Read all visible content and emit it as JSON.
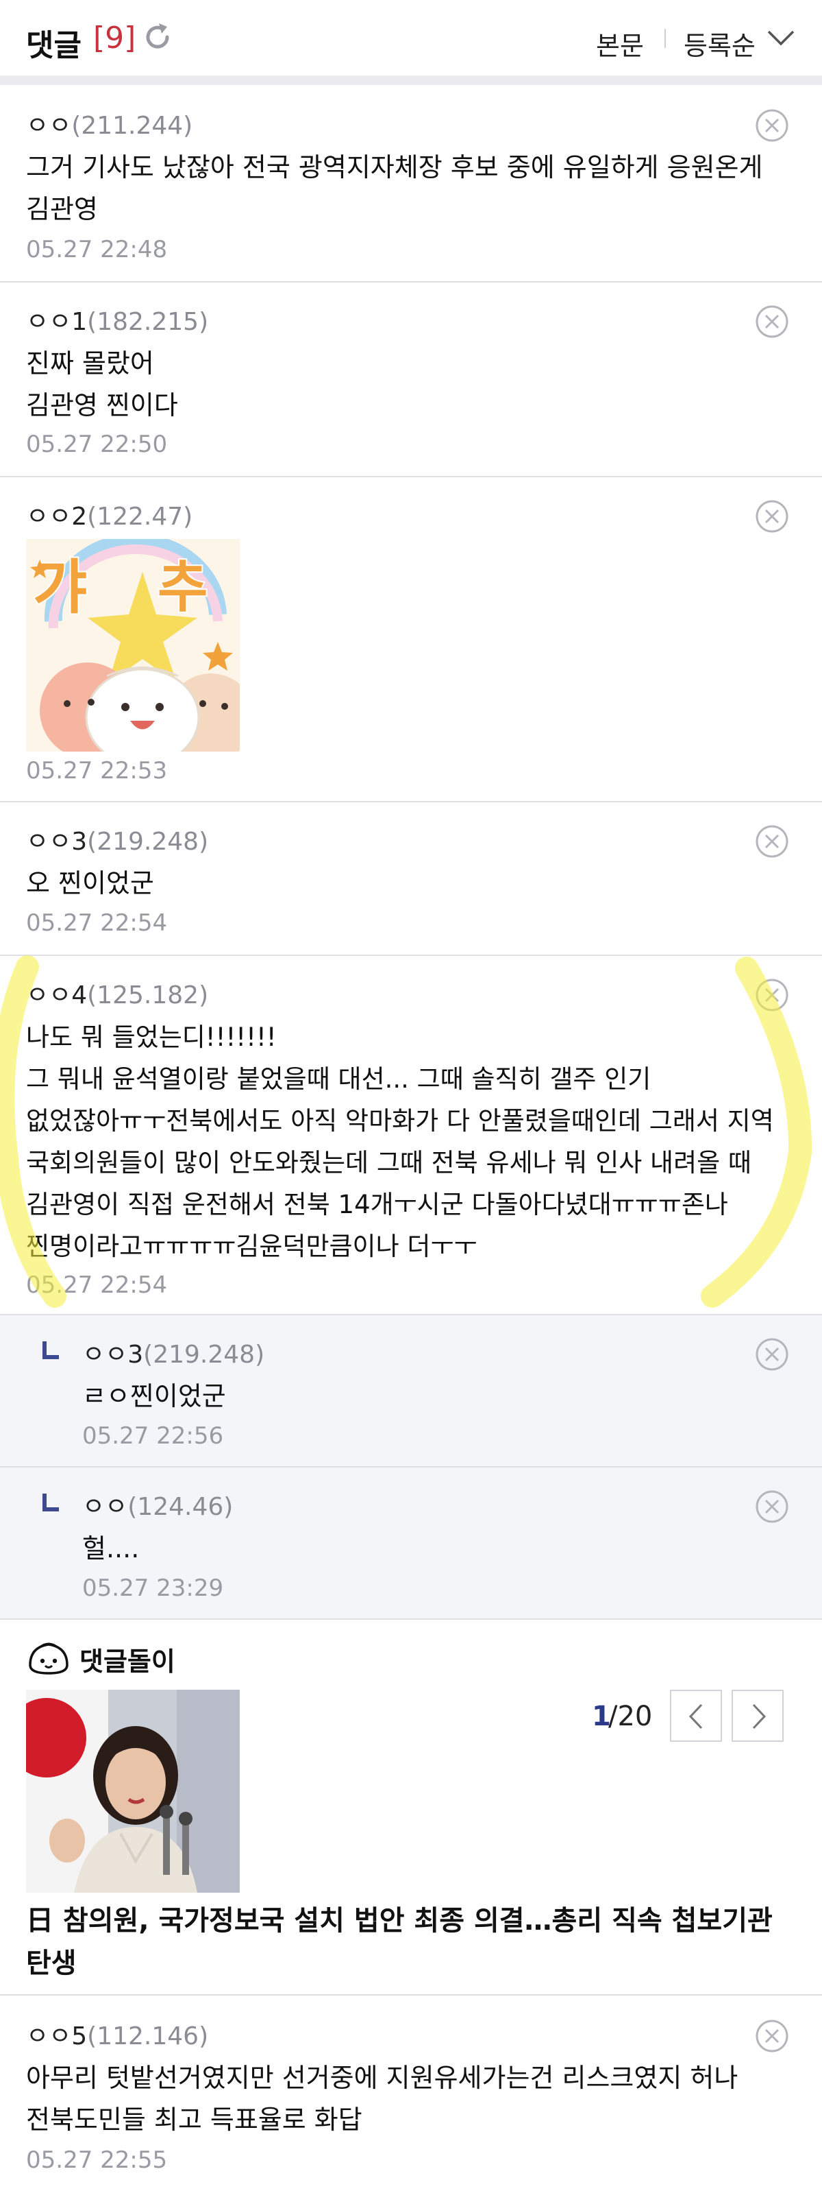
{
  "header": {
    "title": "댓글",
    "count": "[9]",
    "link_body": "본문",
    "link_order": "등록순",
    "accent": "#c8323c"
  },
  "comments": [
    {
      "author": "ㅇㅇ",
      "ip": "(211.244)",
      "text": "그거 기사도 났잖아 전국 광역지자체장 후보 중에 유일하게 응원온게 김관영",
      "date": "05.27 22:48"
    },
    {
      "author": "ㅇㅇ1",
      "ip": "(182.215)",
      "text": "진짜 몰랐어\n김관영 찐이다",
      "date": "05.27 22:50"
    },
    {
      "author": "ㅇㅇ2",
      "ip": "(122.47)",
      "sticker": "갸추",
      "date": "05.27 22:53"
    },
    {
      "author": "ㅇㅇ3",
      "ip": "(219.248)",
      "text": "오 찐이었군",
      "date": "05.27 22:54"
    },
    {
      "author": "ㅇㅇ4",
      "ip": "(125.182)",
      "text": "나도 뭐 들었는디!!!!!!!\n그 뭐내 윤석열이랑 붙었을때 대선... 그때 솔직히 갤주 인기 없었잖아ㅠㅜ전북에서도 아직 악마화가 다 안풀렸을때인데 그래서 지역 국회의원들이 많이 안도와줬는데 그때 전북 유세나 뭐 인사 내려올 때 김관영이 직접 운전해서 전북 14개ㅜ시군 다돌아다녔대ㅠㅠㅠ존나 찐명이라고ㅠㅠㅠㅠ김윤덕만큼이나 더ㅜㅜ",
      "date": "05.27 22:54"
    },
    {
      "author": "ㅇㅇ3",
      "ip": "(219.248)",
      "text": "ㄹㅇ찐이었군",
      "date": "05.27 22:56",
      "reply": true
    },
    {
      "author": "ㅇㅇ",
      "ip": "(124.46)",
      "text": "헐....",
      "date": "05.27 23:29",
      "reply": true
    }
  ],
  "recommendation": {
    "label": "댓글돌이",
    "page_current": "1",
    "page_total": "/20",
    "headline": "日 참의원, 국가정보국 설치 법안 최종 의결…총리 직속 첩보기관 탄생"
  },
  "last_comment": {
    "author": "ㅇㅇ5",
    "ip": "(112.146)",
    "text": "아무리 텃밭선거였지만 선거중에 지원유세가는건 리스크였지 허나 전북도민들 최고 득표율로 화답",
    "date": "05.27 22:55"
  },
  "colors": {
    "ip_gray": "#8b8b93",
    "date_gray": "#9a9aa3",
    "reply_bg": "#f4f5f9",
    "reply_arrow": "#3d4a8f",
    "page_accent": "#2c3a8c",
    "highlighter": "#f4ef3a"
  },
  "icons": {
    "refresh": "refresh-icon",
    "order": "chevron-down-icon",
    "delete": "close-circle-icon",
    "reply": "reply-arrow-icon",
    "mascot": "dumpling-mascot-icon",
    "prev": "chevron-left-icon",
    "next": "chevron-right-icon"
  }
}
